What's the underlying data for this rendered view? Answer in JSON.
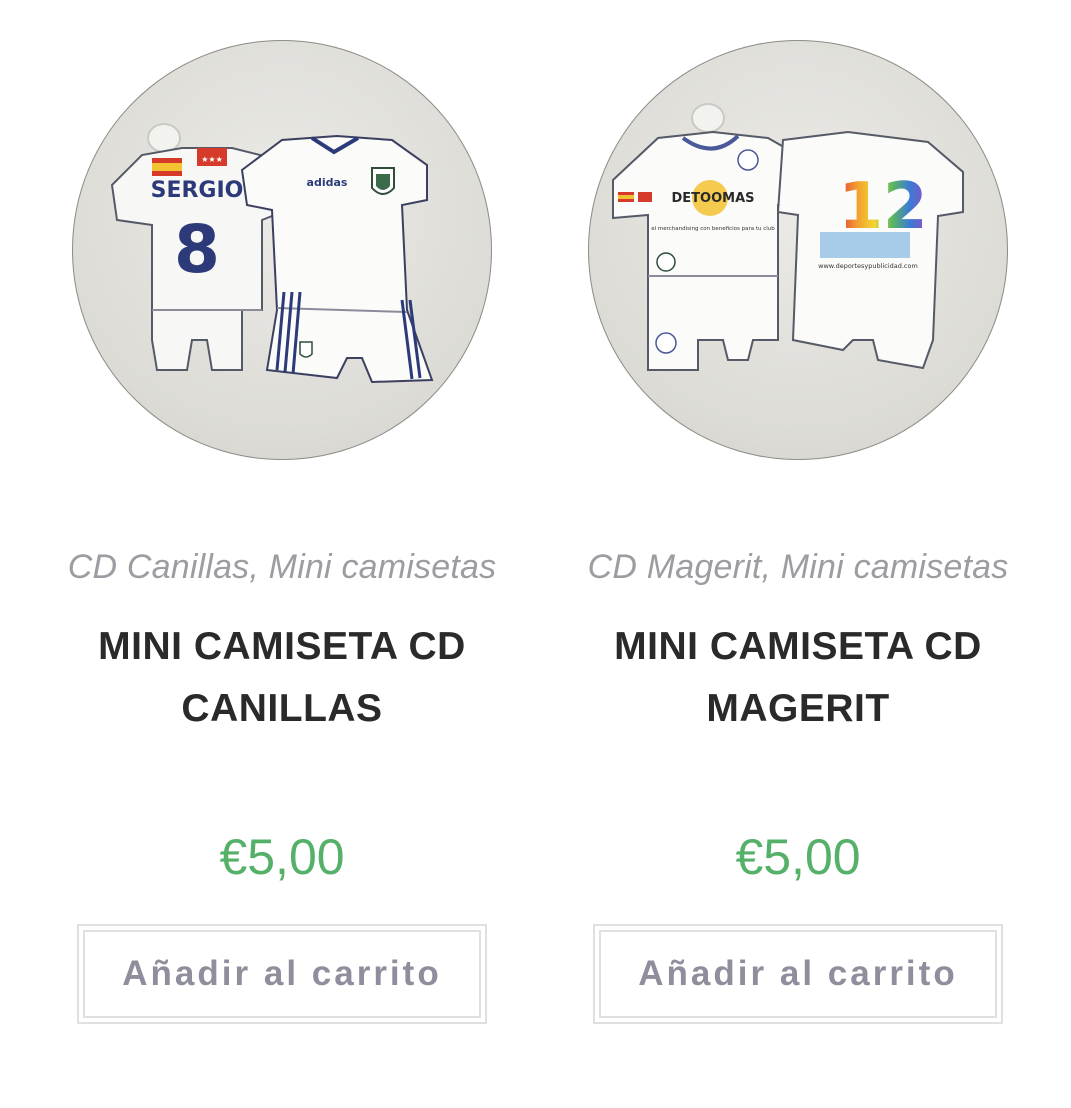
{
  "products": [
    {
      "categories": "CD Canillas, Mini camisetas",
      "title_line1": "MINI CAMISETA CD",
      "title_line2": "CANILLAS",
      "price": "€5,00",
      "button_label": "Añadir al carrito",
      "image": {
        "back_name": "SERGIO",
        "back_number": "8",
        "brand": "adidas"
      }
    },
    {
      "categories": "CD Magerit, Mini camisetas",
      "title_line1": "MINI CAMISETA CD",
      "title_line2": "MAGERIT",
      "price": "€5,00",
      "button_label": "Añadir al carrito",
      "image": {
        "sponsor": "DETOOMAS",
        "sponsor_tagline": "el merchandising con beneficios para tu club",
        "back_number": "12",
        "back_url": "www.deportesypublicidad.com"
      }
    }
  ],
  "colors": {
    "price": "#55b06a",
    "title": "#2a2a2a",
    "categories": "#9c9ca2",
    "button_text": "#8f8e9c",
    "button_border": "#e0e0e3",
    "kit_navy": "#2d3a7a"
  }
}
